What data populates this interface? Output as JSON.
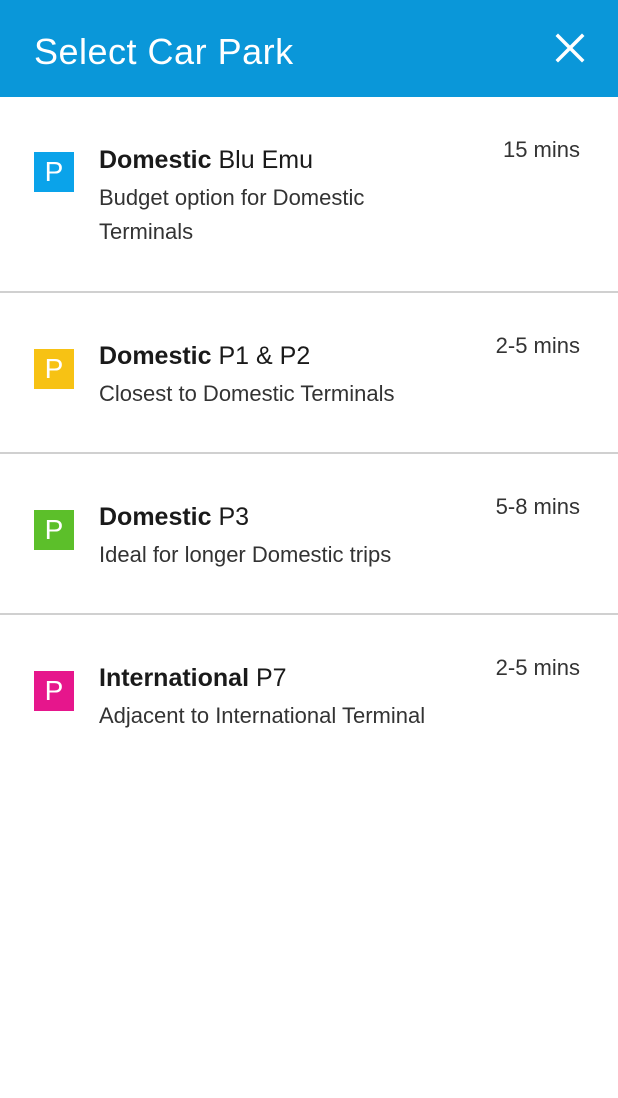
{
  "header": {
    "title": "Select Car Park",
    "close_icon": "close-icon",
    "background_color": "#0a97d9"
  },
  "car_parks": [
    {
      "badge_letter": "P",
      "badge_color": "#0aa3ea",
      "name_bold": "Domestic",
      "name_rest": " Blu Emu",
      "description": "Budget option for Domestic Terminals",
      "time": "15 mins"
    },
    {
      "badge_letter": "P",
      "badge_color": "#f7c214",
      "name_bold": "Domestic",
      "name_rest": " P1 & P2",
      "description": "Closest to Domestic Terminals",
      "time": "2-5 mins"
    },
    {
      "badge_letter": "P",
      "badge_color": "#5cbf2a",
      "name_bold": "Domestic",
      "name_rest": " P3",
      "description": "Ideal for longer Domestic trips",
      "time": "5-8 mins"
    },
    {
      "badge_letter": "P",
      "badge_color": "#e6168c",
      "name_bold": "International",
      "name_rest": " P7",
      "description": "Adjacent to International Terminal",
      "time": "2-5 mins"
    }
  ]
}
